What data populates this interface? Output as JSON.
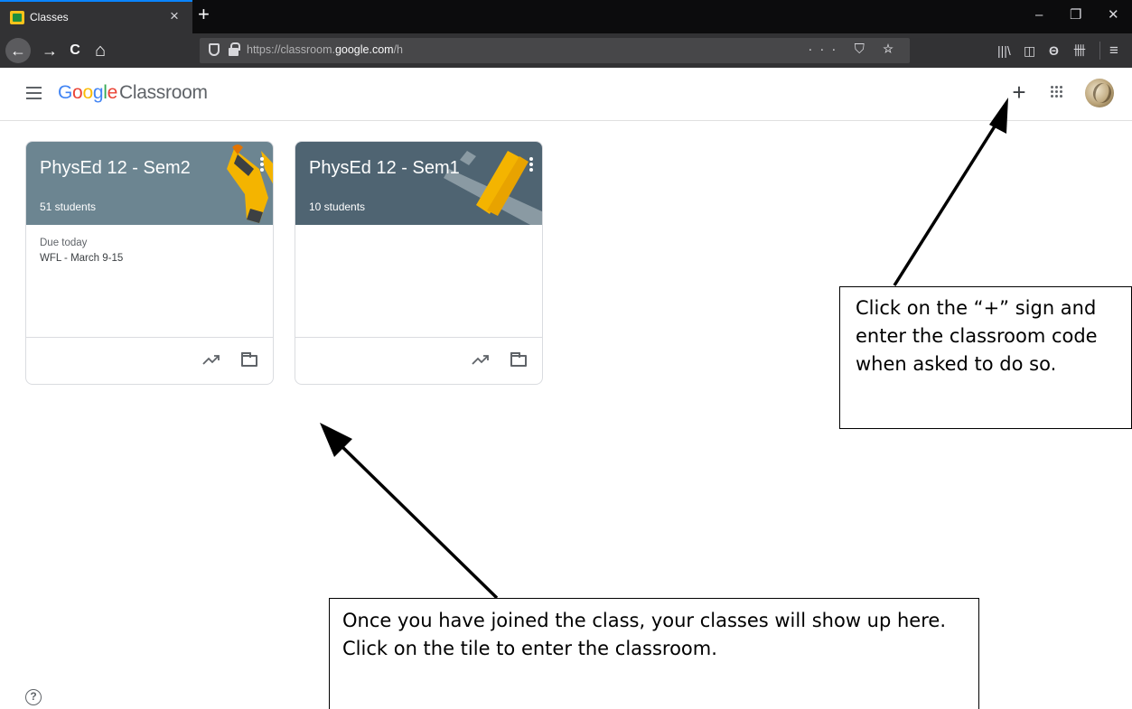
{
  "browser": {
    "tab_title": "Classes",
    "tab_close": "×",
    "new_tab": "+",
    "url_prefix": "https://classroom.",
    "url_domain": "google.com",
    "url_suffix": "/h",
    "url_actions": "··· ⛉ ☆",
    "window_controls": {
      "minimize": "–",
      "restore": "❐",
      "close": "✕"
    },
    "nav": {
      "back": "←",
      "forward": "→",
      "reload": "C",
      "home": "⌂"
    },
    "toolbar": {
      "library": "|||\\",
      "sidebar": "◫",
      "account": "Θ",
      "extension": "卌",
      "menu": "≡"
    }
  },
  "app": {
    "logo_letters": [
      "G",
      "o",
      "o",
      "g",
      "l",
      "e"
    ],
    "product": "Classroom",
    "add_button": "+"
  },
  "classes": [
    {
      "name": "PhysEd 12 - Sem2",
      "students": "51 students",
      "header_color": "#6c8591",
      "due_label": "Due today",
      "due_item": "WFL - March 9-15",
      "illustration": "running-shoes"
    },
    {
      "name": "PhysEd 12 - Sem1",
      "students": "10 students",
      "header_color": "#4f6472",
      "due_label": "",
      "due_item": "",
      "illustration": "dumbbell"
    }
  ],
  "annotations": {
    "plus_instruction": "Click on the “+” sign and enter the classroom code when asked to do so.",
    "tile_instruction": "Once you have joined the class, your classes will show up here. Click on the tile to enter the classroom."
  },
  "help": "?"
}
